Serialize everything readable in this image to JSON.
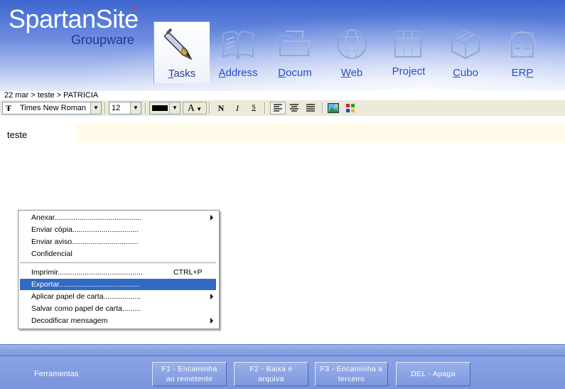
{
  "app": {
    "logo_title": "SpartanSite",
    "logo_reg": "®",
    "logo_sub": "Groupware"
  },
  "modules": [
    {
      "key": "tasks",
      "first": "T",
      "rest": "asks",
      "icon": "pen-icon"
    },
    {
      "key": "address",
      "first": "A",
      "rest": "ddress",
      "icon": "address-book-icon"
    },
    {
      "key": "docum",
      "first": "D",
      "rest": "ocum",
      "icon": "folder-icon"
    },
    {
      "key": "web",
      "first": "W",
      "rest": "eb",
      "icon": "globe-icon"
    },
    {
      "key": "project",
      "label": "Project",
      "icon": "project-building-icon"
    },
    {
      "key": "cubo",
      "first": "C",
      "rest": "ubo",
      "icon": "cube-icon"
    },
    {
      "key": "erp",
      "pre": "ER",
      "first": "P",
      "icon": "erp-building-icon"
    }
  ],
  "breadcrumb": "22 mar  >  teste  >  PATRICIA",
  "toolbar": {
    "font_name": "Times New Roman",
    "font_size": "12",
    "bold": "N",
    "italic": "I",
    "strike": "S",
    "font_color_glyph": "A",
    "text_color": "#000000"
  },
  "editor": {
    "content": "teste"
  },
  "context_menu": {
    "items": [
      {
        "label": "Anexar..........................................",
        "submenu": true
      },
      {
        "label": "Enviar cópia................................"
      },
      {
        "label": "Enviar aviso................................"
      },
      {
        "label": "Confidencial"
      },
      {
        "label": "Imprimir.........................................",
        "shortcut": "CTRL+P"
      },
      {
        "label": "Exportar.......................................",
        "highlighted": true
      },
      {
        "label": "Aplicar papel de carta..................",
        "submenu": true
      },
      {
        "label": "Salvar como papel de carta........."
      },
      {
        "label": "Decodificar mensagem",
        "submenu": true
      }
    ]
  },
  "footer": {
    "tools_label": "Ferramentas",
    "buttons": [
      {
        "line1": "F1 - Encaminha",
        "line2": "ao remetente"
      },
      {
        "line1": "F2 - Baixa e",
        "line2": "arquiva"
      },
      {
        "line1": "F3 - Encaminha a",
        "line2": "terceiro"
      },
      {
        "line1": "DEL - Apaga",
        "line2": ""
      }
    ]
  },
  "colors": {
    "menu_highlight": "#316ac5",
    "header_blue": "#3e66cf",
    "footer_blue": "#7a95dc"
  }
}
